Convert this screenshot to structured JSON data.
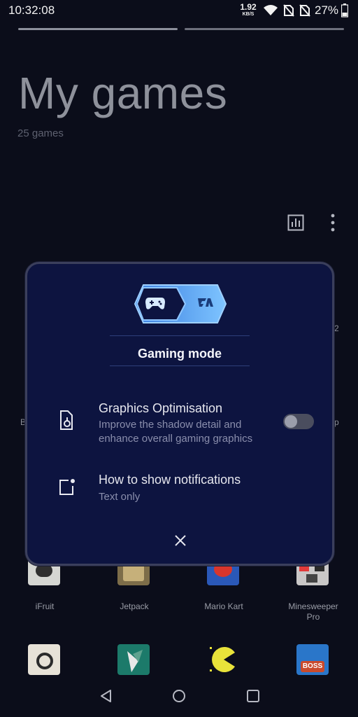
{
  "status_bar": {
    "time": "10:32:08",
    "net_speed_value": "1.92",
    "net_speed_unit": "KB/S",
    "battery": "27%",
    "icons": [
      "wifi-icon",
      "no-sim-icon",
      "no-sim-icon",
      "battery-icon"
    ]
  },
  "header": {
    "title": "My games",
    "count": "25 games",
    "icons": [
      "stats-icon",
      "more-vertical-icon"
    ]
  },
  "background_fragments": {
    "left_letter": "B",
    "right_letter": "p",
    "right_number": "2"
  },
  "games_row1": [
    {
      "label": "iFruit",
      "color": "#d5d6d2"
    },
    {
      "label": "Jetpack",
      "color": "#7d6d49"
    },
    {
      "label": "Mario Kart",
      "color": "#2a58b8"
    },
    {
      "label": "Minesweeper\nPro",
      "color": "#c9c7c7"
    }
  ],
  "games_row2": [
    {
      "color": "#e7e2d7"
    },
    {
      "color": "#1c7a6a"
    },
    {
      "color": "#0b0d1a"
    },
    {
      "color": "#2a76c9"
    }
  ],
  "dialog": {
    "title": "Gaming mode",
    "accent": "#5fa8ff",
    "rows": [
      {
        "title": "Graphics Optimisation",
        "subtitle": "Improve the shadow detail and enhance overall gaming graphics",
        "icon": "thermometer-icon"
      },
      {
        "title": "How to show notifications",
        "subtitle": "Text only",
        "icon": "notification-icon"
      }
    ],
    "toggle_on": false,
    "close_icon": "close-icon"
  },
  "nav_bar": {
    "icons": [
      "back-icon",
      "home-icon",
      "recents-icon"
    ]
  }
}
